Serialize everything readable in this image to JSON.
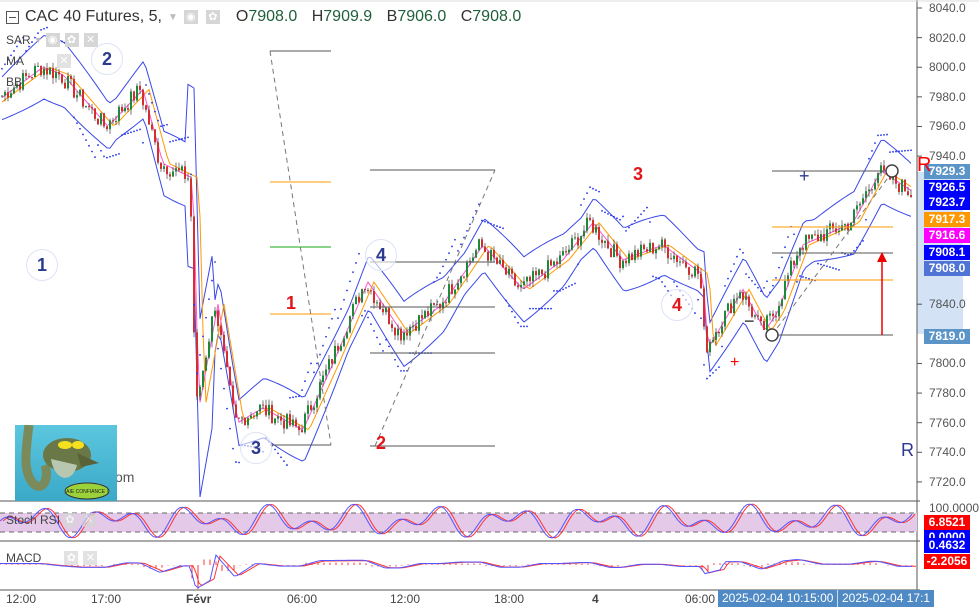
{
  "header": {
    "symbol": "CAC 40 Futures, 5,",
    "open_label": "O",
    "open": "7908.0",
    "high_label": "H",
    "high": "7909.9",
    "low_label": "B",
    "low": "7906.0",
    "close_label": "C",
    "close": "7908.0"
  },
  "indicators": [
    "SAR",
    "MA",
    "BB"
  ],
  "stoch": {
    "label": "Stoch RSI"
  },
  "macd": {
    "label": "MACD"
  },
  "y_axis": [
    "8040.0",
    "8020.0",
    "8000.0",
    "7980.0",
    "7960.0",
    "7940.0",
    "7840.0",
    "7800.0",
    "7780.0",
    "7760.0",
    "7740.0",
    "7720.0"
  ],
  "price_badges": [
    {
      "v": "7929.3",
      "color": "#5b95c8"
    },
    {
      "v": "7926.5",
      "color": "#0000ff"
    },
    {
      "v": "7923.7",
      "color": "#0000ff"
    },
    {
      "v": "7917.3",
      "color": "#ff9800"
    },
    {
      "v": "7916.6",
      "color": "#ff00ff"
    },
    {
      "v": "7908.1",
      "color": "#0000ff"
    },
    {
      "v": "7908.0",
      "color": "#5073d6"
    },
    {
      "v": "7819.0",
      "color": "#5b95c8"
    }
  ],
  "pane_badges": {
    "stoch_top": "100.0000",
    "stoch_k": "6.8521",
    "stoch_d": "0.0000",
    "macd_a": "0.4632",
    "macd_b": "-2.2056"
  },
  "time_axis": [
    "12:00",
    "17:00",
    "Févr",
    "06:00",
    "12:00",
    "18:00",
    "4",
    "06:00"
  ],
  "time_badges": [
    "2025-02-04 10:15:00",
    "2025-02-04 17:1"
  ],
  "annotations": {
    "blue": [
      "1",
      "2",
      "3",
      "4"
    ],
    "red": [
      "1",
      "2",
      "3",
      "4"
    ],
    "r_red": "R",
    "r_blue": "R",
    "plus": "+",
    "minus": "−"
  },
  "mascot": {
    "bubble_text": "AIE CONFIANCE !",
    "partial_text": "om"
  },
  "colors": {
    "bull": "#1b8a3a",
    "bear": "#d32f2f",
    "bands": "#3a48e8",
    "sar": "#2233ee",
    "ma_fast": "#ff55cc",
    "ma_slow": "#ff9900"
  }
}
